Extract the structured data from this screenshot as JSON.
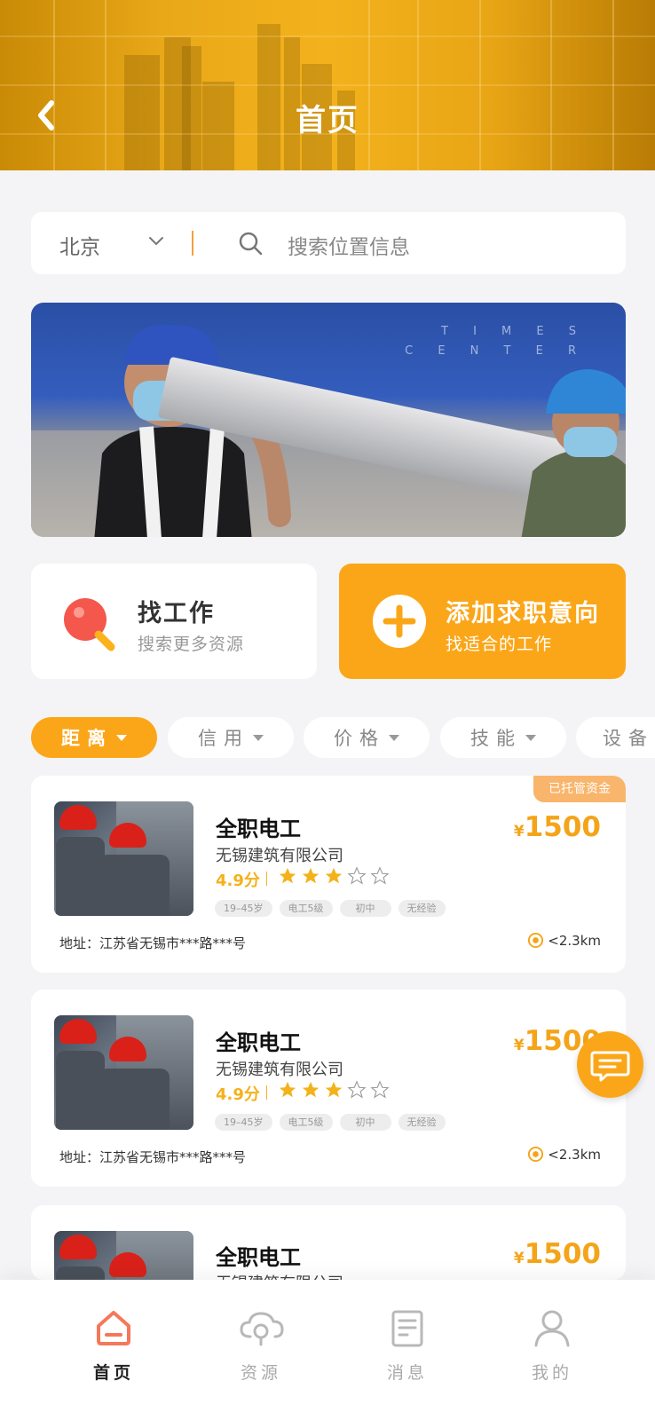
{
  "header": {
    "title": "首页"
  },
  "search": {
    "city": "北京",
    "placeholder": "搜索位置信息"
  },
  "banner": {
    "text_line1": "T I M E S",
    "text_line2": "C E N T E R"
  },
  "actions": {
    "find": {
      "title": "找工作",
      "subtitle": "搜索更多资源"
    },
    "add": {
      "title": "添加求职意向",
      "subtitle": "找适合的工作"
    }
  },
  "filters": [
    {
      "label": "距离",
      "active": true
    },
    {
      "label": "信用",
      "active": false
    },
    {
      "label": "价格",
      "active": false
    },
    {
      "label": "技能",
      "active": false
    },
    {
      "label": "设备",
      "active": false
    }
  ],
  "jobs": [
    {
      "title": "全职电工",
      "company": "无锡建筑有限公司",
      "score": "4.9分",
      "stars": 3,
      "tags": [
        "19–45岁",
        "电工5级",
        "初中",
        "无经验"
      ],
      "currency": "¥",
      "price": "1500",
      "badge": "已托管资金",
      "address": "地址：江苏省无锡市***路***号",
      "distance": "<2.3km"
    },
    {
      "title": "全职电工",
      "company": "无锡建筑有限公司",
      "score": "4.9分",
      "stars": 3,
      "tags": [
        "19–45岁",
        "电工5级",
        "初中",
        "无经验"
      ],
      "currency": "¥",
      "price": "1500",
      "address": "地址：江苏省无锡市***路***号",
      "distance": "<2.3km"
    },
    {
      "title": "全职电工",
      "company": "无锡建筑有限公司",
      "currency": "¥",
      "price": "1500"
    }
  ],
  "tabbar": [
    {
      "label": "首页",
      "icon": "home-icon",
      "active": true
    },
    {
      "label": "资源",
      "icon": "cloud-search-icon",
      "active": false
    },
    {
      "label": "消息",
      "icon": "message-doc-icon",
      "active": false
    },
    {
      "label": "我的",
      "icon": "user-icon",
      "active": false
    }
  ],
  "colors": {
    "accent": "#fba619",
    "price": "#f4a418",
    "star": "#f4b21a"
  }
}
